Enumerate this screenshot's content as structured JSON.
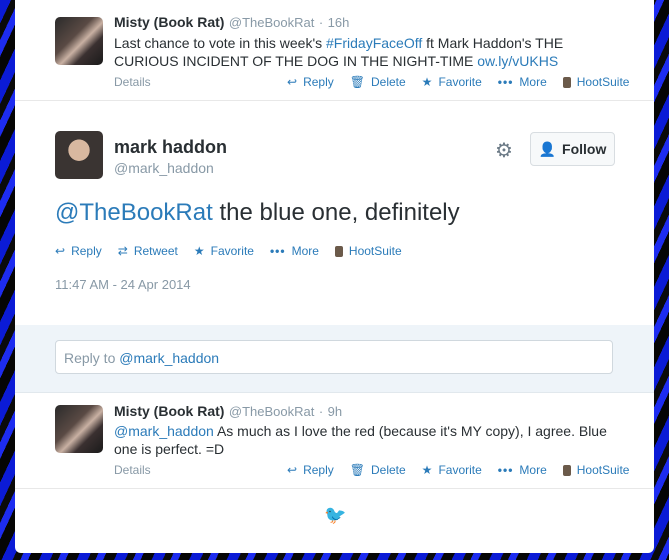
{
  "tweet1": {
    "name": "Misty (Book Rat)",
    "handle": "@TheBookRat",
    "time": "16h",
    "text_a": "Last chance to vote in this week's ",
    "hashtag": "#FridayFaceOff",
    "text_b": " ft Mark Haddon's THE CURIOUS INCIDENT OF THE DOG IN THE NIGHT-TIME ",
    "link": "ow.ly/vUKHS",
    "details": "Details",
    "reply": "Reply",
    "delete": "Delete",
    "favorite": "Favorite",
    "more": "More",
    "hootsuite": "HootSuite"
  },
  "main": {
    "name": "mark haddon",
    "handle": "@mark_haddon",
    "follow": "Follow",
    "mention": "@TheBookRat",
    "text": " the blue one, definitely",
    "reply": "Reply",
    "retweet": "Retweet",
    "favorite": "Favorite",
    "more": "More",
    "hootsuite": "HootSuite",
    "timestamp": "11:47 AM - 24 Apr 2014"
  },
  "reply_box": {
    "prefix": "Reply to ",
    "mention": "@mark_haddon"
  },
  "tweet2": {
    "name": "Misty (Book Rat)",
    "handle": "@TheBookRat",
    "time": "9h",
    "mention": "@mark_haddon",
    "text": " As much as I love the red (because it's MY copy), I agree. Blue one is perfect. =D",
    "details": "Details",
    "reply": "Reply",
    "delete": "Delete",
    "favorite": "Favorite",
    "more": "More",
    "hootsuite": "HootSuite"
  },
  "colors": {
    "link": "#2b7bb9",
    "text": "#292f33",
    "muted": "#8899a6"
  }
}
